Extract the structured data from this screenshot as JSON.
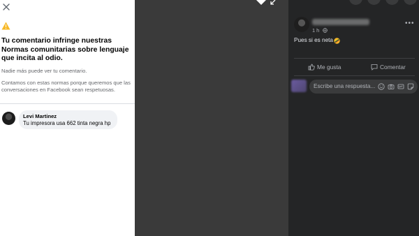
{
  "notice": {
    "title": "Tu comentario infringe nuestras Normas comunitarias sobre lenguaje que incita al odio.",
    "para1": "Nadie más puede ver tu comentario.",
    "para2": "Contamos con estas normas porque queremos que las conversaciones en Facebook sean respetuosas.",
    "comment": {
      "author": "Levi Martinez",
      "text": "Tu impresora usa 662 tinta negra hp"
    }
  },
  "post": {
    "time": "1 h",
    "text": "Pues si es neta",
    "actions": {
      "like": "Me gusta",
      "comment": "Comentar"
    },
    "reply_placeholder": "Escribe una respuesta..."
  },
  "colors": {
    "warning": "#f7b928",
    "accent": "#1877f2",
    "panel_bg": "#242526"
  }
}
